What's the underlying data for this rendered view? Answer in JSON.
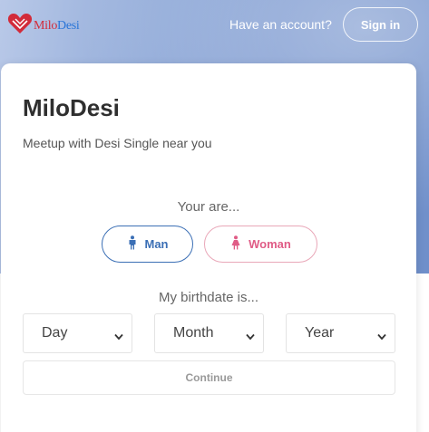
{
  "header": {
    "logo": {
      "text_main": "Milo",
      "text_accent": "Desi",
      "icon": "heart-logo-icon"
    },
    "have_account": "Have an account?",
    "signin_label": "Sign in"
  },
  "card": {
    "title": "MiloDesi",
    "subtitle": "Meetup with Desi Single near you",
    "gender_prompt": "Your are...",
    "gender_options": [
      {
        "label": "Man",
        "icon": "male-icon",
        "color": "#3b6fb5"
      },
      {
        "label": "Woman",
        "icon": "female-icon",
        "color": "#e05c86"
      }
    ],
    "birthdate_prompt": "My birthdate is...",
    "selects": {
      "day": "Day",
      "month": "Month",
      "year": "Year"
    },
    "continue_label": "Continue"
  },
  "colors": {
    "brand_red": "#d22b3a",
    "brand_blue": "#2a75d8",
    "hero_gradient": [
      "#b9c9e8",
      "#6f8fca"
    ]
  }
}
